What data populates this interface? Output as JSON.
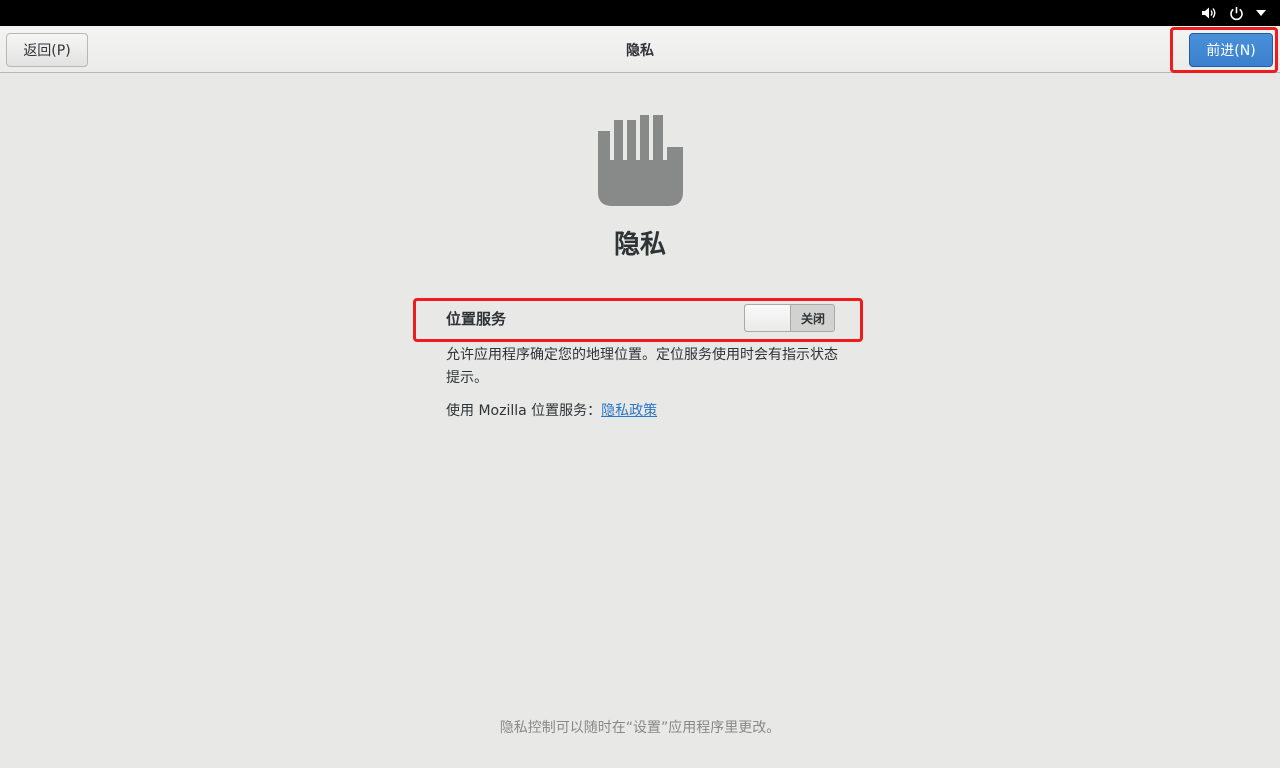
{
  "header": {
    "back_label": "返回(P)",
    "title": "隐私",
    "next_label": "前进(N)"
  },
  "topbar": {
    "icons": [
      "volume-icon",
      "power-icon",
      "dropdown-arrow-icon"
    ]
  },
  "main": {
    "icon": "hand-stop-icon",
    "heading": "隐私",
    "location_service": {
      "label": "位置服务",
      "toggle_state": "关闭",
      "enabled": false
    },
    "description": "允许应用程序确定您的地理位置。定位服务使用时会有指示状态提示。",
    "mozilla_prefix": "使用 Mozilla 位置服务：",
    "privacy_policy_link": "隐私政策"
  },
  "footer": {
    "note": "隐私控制可以随时在“设置”应用程序里更改。"
  },
  "colors": {
    "accent": "#3a80cc",
    "highlight": "#ee1c1c",
    "link": "#2a76c6",
    "background": "#e8e8e7"
  }
}
